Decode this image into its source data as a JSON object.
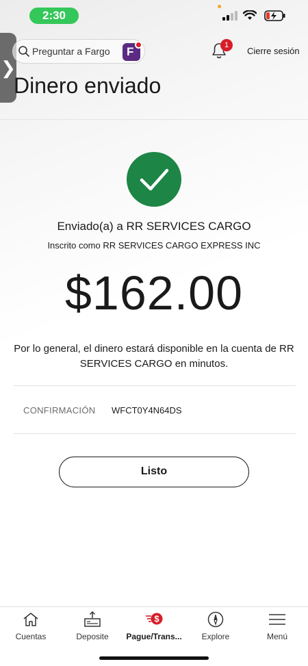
{
  "status": {
    "time": "2:30"
  },
  "header": {
    "search_label": "Preguntar a Fargo",
    "notifications_count": "1",
    "signout_label": "Cierre sesión"
  },
  "page": {
    "title": "Dinero enviado"
  },
  "confirmation": {
    "sent_to": "Enviado(a) a RR SERVICES CARGO",
    "enrolled_as": "Inscrito como RR SERVICES CARGO EXPRESS INC",
    "amount": "$162.00",
    "availability_text": "Por lo general, el dinero estará disponible en la cuenta de RR SERVICES CARGO en minutos.",
    "confirmation_label": "CONFIRMACIÓN",
    "confirmation_number": "WFCT0Y4N64DS",
    "done_button": "Listo"
  },
  "nav": {
    "items": [
      {
        "label": "Cuentas",
        "icon": "home-icon"
      },
      {
        "label": "Deposite",
        "icon": "deposit-icon"
      },
      {
        "label": "Pague/Trans...",
        "icon": "pay-transfer-icon",
        "active": true
      },
      {
        "label": "Explore",
        "icon": "compass-icon"
      },
      {
        "label": "Menú",
        "icon": "menu-icon"
      }
    ]
  },
  "colors": {
    "success_green": "#1d8545",
    "accent_red": "#d71e28",
    "fargo_purple": "#5b2a82"
  }
}
